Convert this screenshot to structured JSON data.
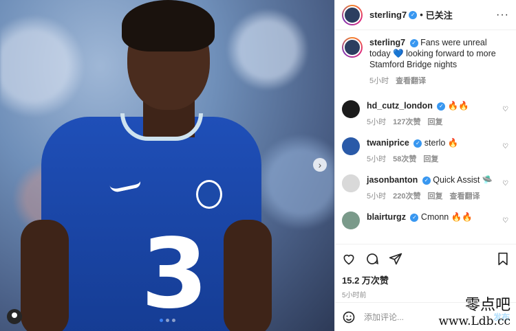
{
  "post": {
    "username": "sterling7",
    "follow_status": "已关注",
    "caption_user": "sterling7",
    "caption_text": "Fans were unreal today 💙 looking forward to more Stamford Bridge nights",
    "caption_time": "5小时",
    "caption_translate": "查看翻译"
  },
  "comments": [
    {
      "user": "hd_cutz_london",
      "text": "🔥🔥",
      "time": "5小时",
      "likes": "127次赞",
      "reply": "回复",
      "translate": ""
    },
    {
      "user": "twaniprice",
      "text": "sterlo 🔥",
      "time": "5小时",
      "likes": "58次赞",
      "reply": "回复",
      "translate": ""
    },
    {
      "user": "jasonbanton",
      "text": "Quick Assist 🛸",
      "time": "5小时",
      "likes": "220次赞",
      "reply": "回复",
      "translate": "查看翻译"
    },
    {
      "user": "blairturgz",
      "text": "Cmonn 🔥🔥",
      "time": "",
      "likes": "",
      "reply": "",
      "translate": ""
    }
  ],
  "stats": {
    "likes": "15.2 万次赞",
    "posted": "5小时前"
  },
  "comment_box": {
    "placeholder": "添加评论...",
    "post_label": "发布"
  },
  "watermark": {
    "cn": "零点吧",
    "url": "www.Ldb.cc"
  },
  "icons": {
    "more": "more-icon",
    "like": "heart-icon",
    "comment": "comment-icon",
    "share": "share-icon",
    "save": "bookmark-icon",
    "emoji": "emoji-icon"
  }
}
